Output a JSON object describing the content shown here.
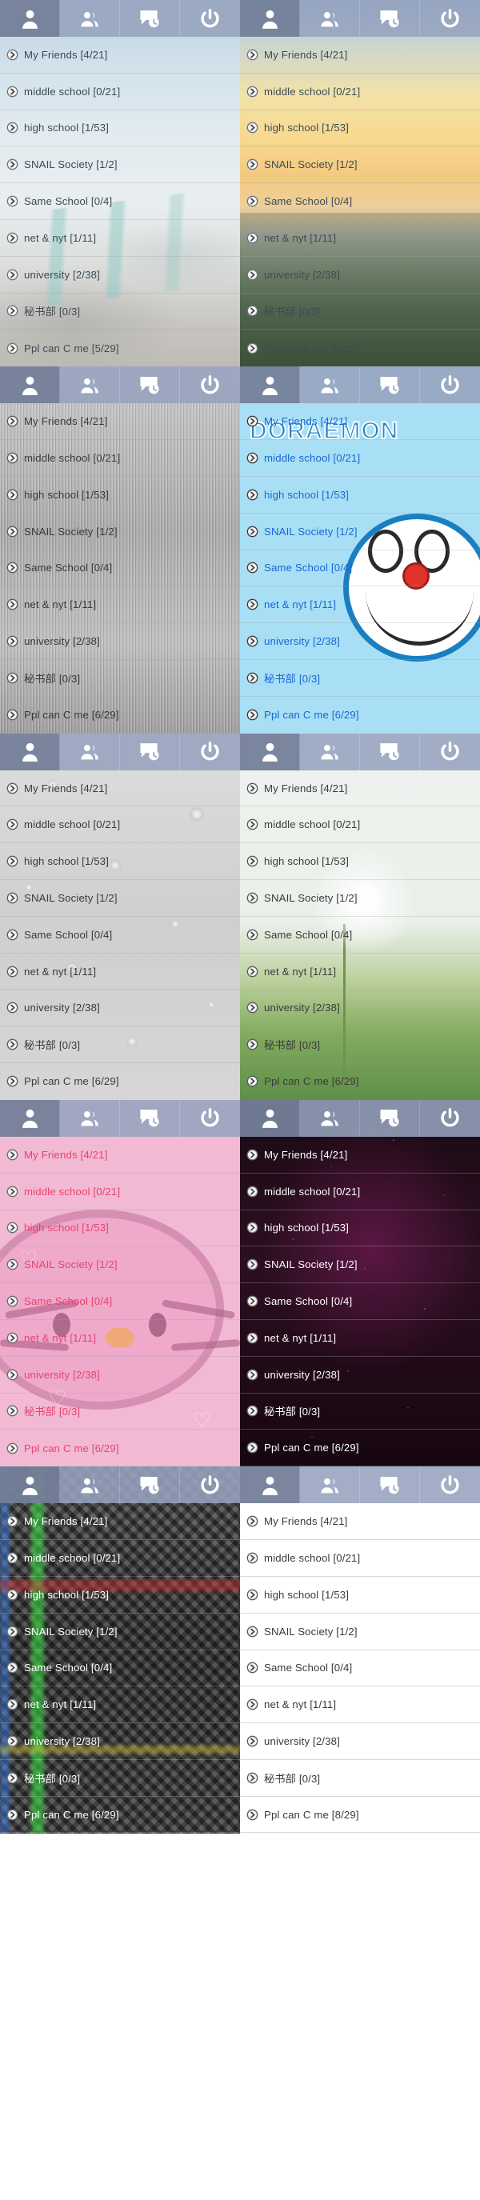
{
  "app": {
    "toolbar": {
      "buttons": [
        {
          "name": "profile",
          "icon": "person-icon",
          "active": true
        },
        {
          "name": "friends",
          "icon": "people-group-icon",
          "active": false
        },
        {
          "name": "recent-chats",
          "icon": "chat-clock-icon",
          "active": false
        },
        {
          "name": "power",
          "icon": "power-icon",
          "active": false
        }
      ]
    },
    "list_arrow_icon": "chevron-right-circle-icon"
  },
  "groups_default": [
    {
      "label": "My Friends [4/21]"
    },
    {
      "label": "middle school [0/21]"
    },
    {
      "label": "high school [1/53]"
    },
    {
      "label": "SNAIL Society [1/2]"
    },
    {
      "label": "Same School [0/4]"
    },
    {
      "label": "net & nyt [1/11]"
    },
    {
      "label": "university [2/38]"
    },
    {
      "label": "秘书部 [0/3]"
    },
    {
      "label": "Ppl can C me [5/29]"
    }
  ],
  "panels": [
    {
      "id": "panel-beach",
      "theme_name": "beach-pebbles",
      "text_color": "#3e4a55",
      "rows": [
        {
          "label": "My Friends [4/21]"
        },
        {
          "label": "middle school [0/21]"
        },
        {
          "label": "high school [1/53]"
        },
        {
          "label": "SNAIL Society [1/2]"
        },
        {
          "label": "Same School [0/4]"
        },
        {
          "label": "net & nyt [1/11]"
        },
        {
          "label": "university [2/38]"
        },
        {
          "label": "秘书部 [0/3]"
        },
        {
          "label": "Ppl can C me [5/29]"
        }
      ]
    },
    {
      "id": "panel-sunset",
      "theme_name": "sunset-sky",
      "text_color": "#3e4a55",
      "rows": [
        {
          "label": "My Friends [4/21]"
        },
        {
          "label": "middle school [0/21]"
        },
        {
          "label": "high school [1/53]"
        },
        {
          "label": "SNAIL Society [1/2]"
        },
        {
          "label": "Same School [0/4]"
        },
        {
          "label": "net & nyt [1/11]"
        },
        {
          "label": "university [2/38]"
        },
        {
          "label": "秘书部 [0/3]"
        },
        {
          "label": "Ppl can C me [5/29]"
        }
      ]
    },
    {
      "id": "panel-metal",
      "theme_name": "brushed-metal",
      "text_color": "#3a3a3a",
      "rows": [
        {
          "label": "My Friends [4/21]"
        },
        {
          "label": "middle school [0/21]"
        },
        {
          "label": "high school [1/53]"
        },
        {
          "label": "SNAIL Society [1/2]"
        },
        {
          "label": "Same School [0/4]"
        },
        {
          "label": "net & nyt [1/11]"
        },
        {
          "label": "university [2/38]"
        },
        {
          "label": "秘书部 [0/3]"
        },
        {
          "label": "Ppl can C me [6/29]"
        }
      ]
    },
    {
      "id": "panel-doraemon",
      "theme_name": "doraemon-blue",
      "text_color": "#1668d6",
      "watermark": "DORAEMON",
      "rows": [
        {
          "label": "My Friends [4/21]"
        },
        {
          "label": "middle school [0/21]"
        },
        {
          "label": "high school [1/53]"
        },
        {
          "label": "SNAIL Society [1/2]"
        },
        {
          "label": "Same School [0/4]"
        },
        {
          "label": "net & nyt [1/11]"
        },
        {
          "label": "university [2/38]"
        },
        {
          "label": "秘书部 [0/3]"
        },
        {
          "label": "Ppl can C me [6/29]"
        }
      ]
    },
    {
      "id": "panel-droplets",
      "theme_name": "water-droplets",
      "text_color": "#3a3a3a",
      "rows": [
        {
          "label": "My Friends [4/21]"
        },
        {
          "label": "middle school [0/21]"
        },
        {
          "label": "high school [1/53]"
        },
        {
          "label": "SNAIL Society [1/2]"
        },
        {
          "label": "Same School [0/4]"
        },
        {
          "label": "net & nyt [1/11]"
        },
        {
          "label": "university [2/38]"
        },
        {
          "label": "秘书部 [0/3]"
        },
        {
          "label": "Ppl can C me [6/29]"
        }
      ]
    },
    {
      "id": "panel-dandelion",
      "theme_name": "dandelion-field",
      "text_color": "#3a3a3a",
      "rows": [
        {
          "label": "My Friends [4/21]"
        },
        {
          "label": "middle school [0/21]"
        },
        {
          "label": "high school [1/53]"
        },
        {
          "label": "SNAIL Society [1/2]"
        },
        {
          "label": "Same School [0/4]"
        },
        {
          "label": "net & nyt [1/11]"
        },
        {
          "label": "university [2/38]"
        },
        {
          "label": "秘书部 [0/3]"
        },
        {
          "label": "Ppl can C me [6/29]"
        }
      ]
    },
    {
      "id": "panel-kitty",
      "theme_name": "hello-kitty-pink",
      "text_color": "#e8436f",
      "rows": [
        {
          "label": "My Friends [4/21]"
        },
        {
          "label": "middle school [0/21]"
        },
        {
          "label": "high school [1/53]"
        },
        {
          "label": "SNAIL Society [1/2]"
        },
        {
          "label": "Same School [0/4]"
        },
        {
          "label": "net & nyt [1/11]"
        },
        {
          "label": "university [2/38]"
        },
        {
          "label": "秘书部 [0/3]"
        },
        {
          "label": "Ppl can C me [6/29]"
        }
      ]
    },
    {
      "id": "panel-glitter",
      "theme_name": "dark-purple-glitter",
      "text_color": "#ffffff",
      "rows": [
        {
          "label": "My Friends [4/21]"
        },
        {
          "label": "middle school [0/21]"
        },
        {
          "label": "high school [1/53]"
        },
        {
          "label": "SNAIL Society [1/2]"
        },
        {
          "label": "Same School [0/4]"
        },
        {
          "label": "net & nyt [1/11]"
        },
        {
          "label": "university [2/38]"
        },
        {
          "label": "秘书部 [0/3]"
        },
        {
          "label": "Ppl can C me [6/29]"
        }
      ]
    },
    {
      "id": "panel-studs",
      "theme_name": "dark-studs-neon",
      "text_color": "#ffffff",
      "rows": [
        {
          "label": "My Friends [4/21]"
        },
        {
          "label": "middle school [0/21]"
        },
        {
          "label": "high school [1/53]"
        },
        {
          "label": "SNAIL Society [1/2]"
        },
        {
          "label": "Same School [0/4]"
        },
        {
          "label": "net & nyt [1/11]"
        },
        {
          "label": "university [2/38]"
        },
        {
          "label": "秘书部 [0/3]"
        },
        {
          "label": "Ppl can C me [6/29]"
        }
      ]
    },
    {
      "id": "panel-white",
      "theme_name": "plain-white",
      "text_color": "#3a3a3a",
      "rows": [
        {
          "label": "My Friends [4/21]"
        },
        {
          "label": "middle school [0/21]"
        },
        {
          "label": "high school [1/53]"
        },
        {
          "label": "SNAIL Society [1/2]"
        },
        {
          "label": "Same School [0/4]"
        },
        {
          "label": "net & nyt [1/11]"
        },
        {
          "label": "university [2/38]"
        },
        {
          "label": "秘书部 [0/3]"
        },
        {
          "label": "Ppl can C me [8/29]"
        }
      ]
    }
  ]
}
